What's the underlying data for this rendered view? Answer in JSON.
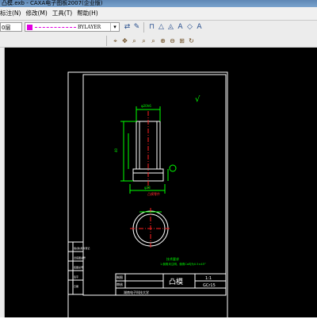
{
  "window": {
    "title": "凸模.exb - CAXA电子图板2007(企业版)"
  },
  "menu": {
    "items": [
      "标注(N)",
      "修改(M)",
      "工具(T)",
      "帮助(H)"
    ]
  },
  "toolbar": {
    "layer_value": "0层",
    "linetype_value": "BYLAYER",
    "color_accent": "#e000e0"
  },
  "drawing": {
    "part_name": "凸模",
    "school": "湖南电子科技大学",
    "scale": "1:1",
    "tech_title": "技术要求",
    "tech_note": "1.倒角未注明，倒角Ca均为0.5×45°",
    "roughness_symbol": "√",
    "title_block": {
      "label_a": "制图",
      "label_b": "审核",
      "right_a": "1:1",
      "right_b": "GCr15"
    },
    "side_labels": [
      "借(通)用件登记",
      "旧底图总号",
      "底图总号",
      "签字",
      "日期"
    ]
  }
}
